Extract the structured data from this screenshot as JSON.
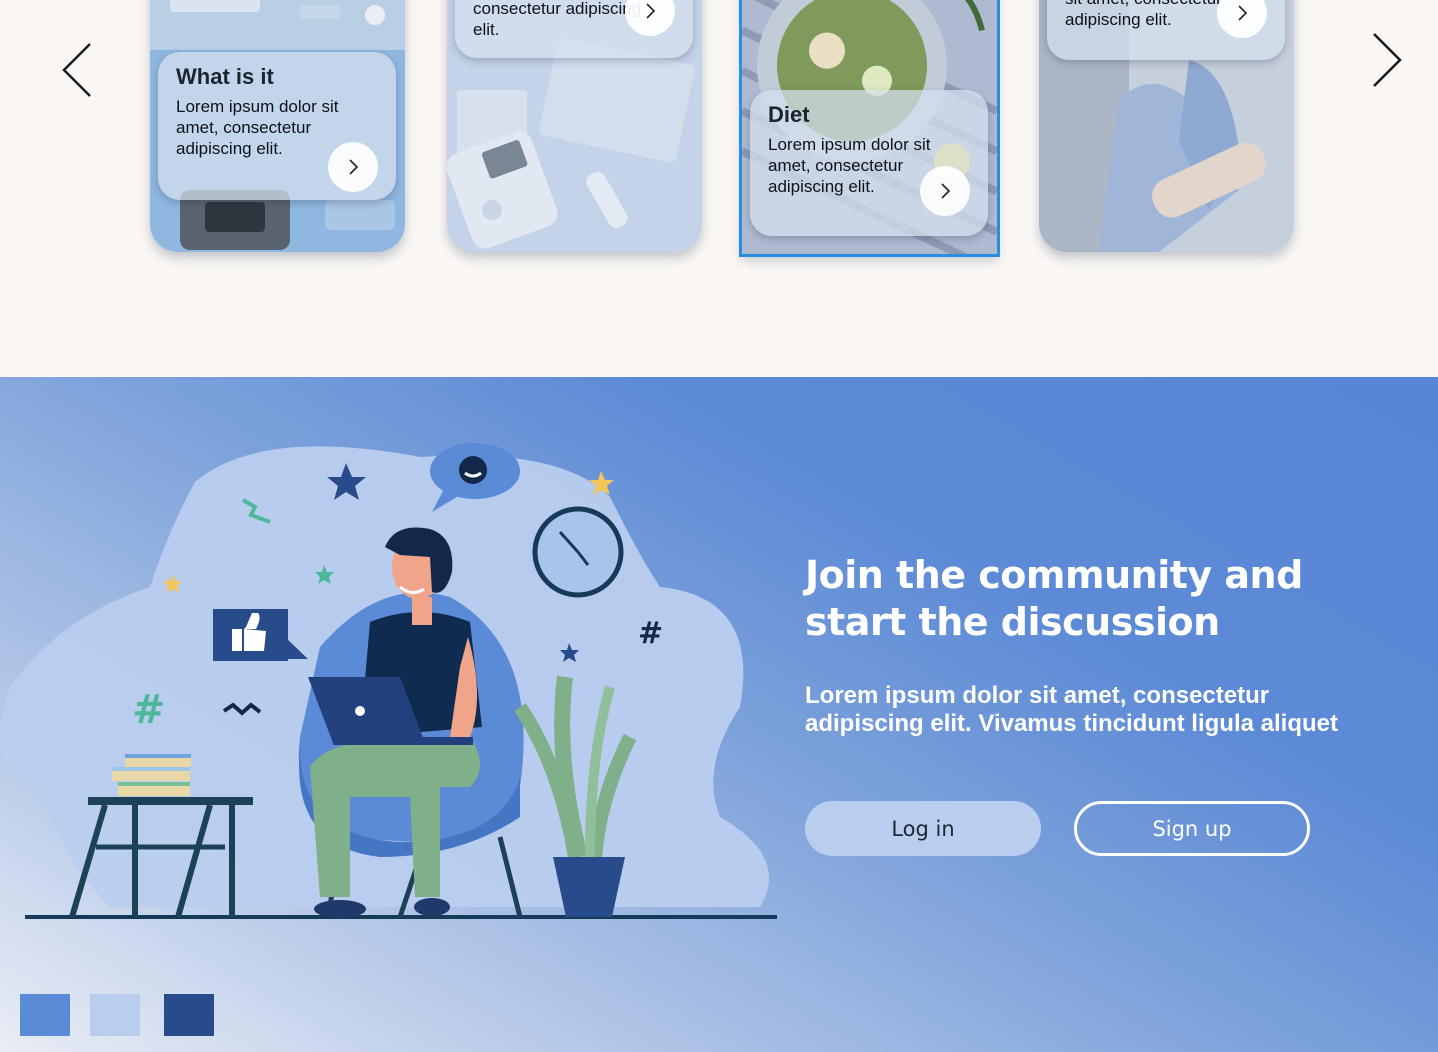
{
  "carousel": {
    "cards": [
      {
        "title": "What is it",
        "text": "Lorem ipsum dolor sit amet, consectetur adipiscing elit."
      },
      {
        "title": "",
        "text": "consectetur adipiscing elit."
      },
      {
        "title": "Diet",
        "text": "Lorem ipsum dolor sit amet, consectetur adipiscing elit."
      },
      {
        "title": "",
        "text": "sit amet, consectetur adipiscing elit."
      }
    ]
  },
  "community": {
    "title": "Join the community and start the discussion",
    "text": "Lorem ipsum dolor sit amet, consectetur adipiscing elit. Vivamus tincidunt ligula aliquet",
    "login_label": "Log in",
    "signup_label": "Sign up"
  },
  "palette": [
    "#5b8ad6",
    "#b9cdee",
    "#284b8c"
  ]
}
